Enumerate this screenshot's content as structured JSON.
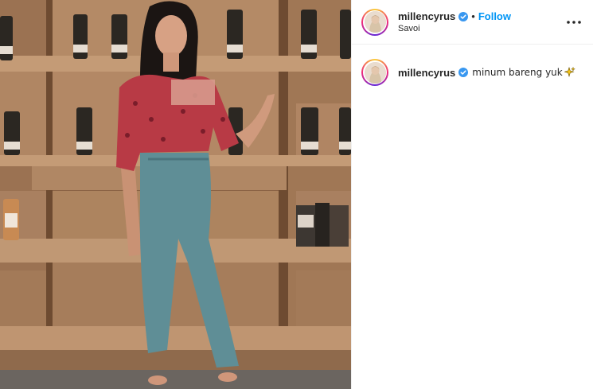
{
  "header": {
    "username": "millencyrus",
    "separator": "•",
    "follow_label": "Follow",
    "location": "Savoi"
  },
  "caption": {
    "username": "millencyrus",
    "text": "minum bareng yuk"
  },
  "icons": {
    "verified": "verified-badge-icon",
    "more": "more-options-icon",
    "sparkle": "sparkles-emoji-icon"
  },
  "colors": {
    "link": "#0095f6",
    "text": "#262626",
    "verified": "#3897f0",
    "divider": "#efefef"
  }
}
